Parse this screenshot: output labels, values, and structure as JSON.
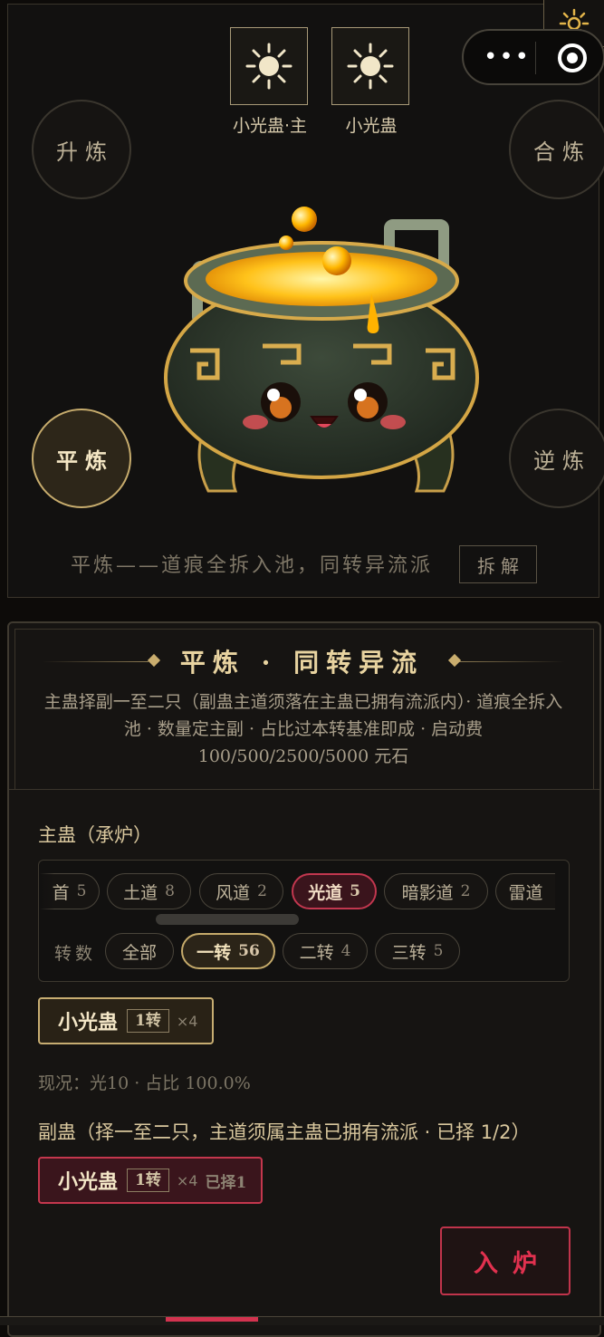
{
  "slots": [
    {
      "label": "小光蛊·主",
      "icon": "sun-icon"
    },
    {
      "label": "小光蛊",
      "icon": "sun-icon"
    }
  ],
  "capsule": {
    "more_icon": "more-dots-icon",
    "close_icon": "target-icon"
  },
  "modes": {
    "upgrade": "升炼",
    "merge": "合炼",
    "flat": "平炼",
    "reverse": "逆炼",
    "active": "平炼"
  },
  "mode_description": "平炼——道痕全拆入池，同转异流派",
  "dismantle_label": "拆解",
  "section": {
    "title": "平炼 · 同转异流",
    "description": "主蛊择副一至二只（副蛊主道须落在主蛊已拥有流派内）· 道痕全拆入池 · 数量定主副 · 占比过本转基准即成 · 启动费 100/500/2500/5000 元石"
  },
  "main_gu": {
    "label": "主蛊（承炉）",
    "paths": [
      {
        "name": "首",
        "count": "5"
      },
      {
        "name": "土道",
        "count": "8"
      },
      {
        "name": "风道",
        "count": "2"
      },
      {
        "name": "光道",
        "count": "5",
        "selected": true
      },
      {
        "name": "暗影道",
        "count": "2"
      },
      {
        "name": "雷道",
        "count": ""
      }
    ],
    "tier_label": "转数",
    "tiers": [
      {
        "name": "全部",
        "count": ""
      },
      {
        "name": "一转",
        "count": "56",
        "selected": true
      },
      {
        "name": "二转",
        "count": "4"
      },
      {
        "name": "三转",
        "count": "5"
      }
    ],
    "card": {
      "name": "小光蛊",
      "tier": "1转",
      "mult": "×4"
    },
    "status": "现况：光10 · 占比 100.0%"
  },
  "sub_gu": {
    "label": "副蛊（择一至二只，主道须属主蛊已拥有流派 · 已择 1/2）",
    "card": {
      "name": "小光蛊",
      "tier": "1转",
      "mult": "×4",
      "picked": "已择1"
    }
  },
  "furnace_label": "入炉",
  "colors": {
    "gold": "#c7ad72",
    "red": "#c2374f",
    "background": "#0d0b09"
  }
}
